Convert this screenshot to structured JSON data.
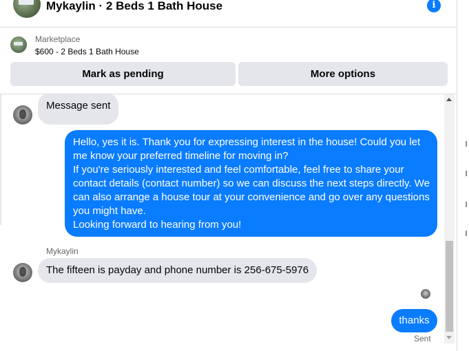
{
  "header": {
    "title": "Mykaylin · 2 Beds 1 Bath House",
    "info_icon": "info-icon"
  },
  "marketplace": {
    "label": "Marketplace",
    "listing_title": "$600 - 2 Beds 1 Bath House",
    "buttons": {
      "mark_pending": "Mark as pending",
      "more_options": "More options"
    }
  },
  "messages": {
    "first_incoming": "Message sent",
    "outgoing_lines": [
      "Hello, yes it is. Thank you for expressing interest in the house! Could you let",
      "me know your preferred timeline for moving in?",
      "If you're seriously interested and feel comfortable, feel free to share your",
      "contact details (contact number) so we can discuss the next steps directly. We",
      "can also arrange a house tour at your convenience and go over any questions",
      "you might have.",
      "Looking forward to hearing from you!"
    ],
    "sender_name": "Mykaylin",
    "second_incoming": "The fifteen is payday and phone number is 256-675-5976",
    "last_outgoing": "thanks",
    "status": "Sent"
  },
  "colors": {
    "outgoing_bubble": "#0a7cff",
    "incoming_bubble": "#e4e6eb",
    "button_bg": "#e4e6eb",
    "secondary_text": "#65676b"
  }
}
